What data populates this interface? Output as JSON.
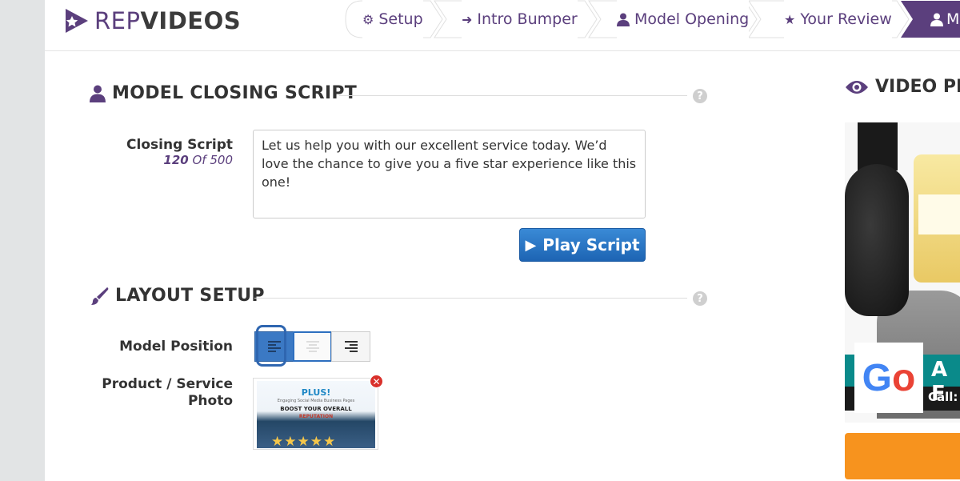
{
  "brand": {
    "rep": "REP",
    "videos": "VIDEOS",
    "accent": "#5b3f7d"
  },
  "steps": [
    {
      "label": "Setup",
      "icon": "gear-icon"
    },
    {
      "label": "Intro Bumper",
      "icon": "sign-in-icon"
    },
    {
      "label": "Model Opening",
      "icon": "user-icon"
    },
    {
      "label": "Your Review",
      "icon": "star-icon"
    },
    {
      "label": "M",
      "icon": "user-icon",
      "active": true
    }
  ],
  "closing": {
    "title": "MODEL CLOSING SCRIPT",
    "field_label": "Closing Script",
    "count": "120",
    "count_of": "Of 500",
    "script_text": "Let us help you with our excellent service today. We’d love the chance to give you a five star experience like this one!",
    "play_label": "Play Script"
  },
  "layout": {
    "title": "LAYOUT SETUP",
    "model_position_label": "Model Position",
    "position_options": [
      "left",
      "center",
      "right"
    ],
    "selected_position": "left",
    "photo_label_line1": "Product / Service",
    "photo_label_line2": "Photo",
    "photo": {
      "line1": "PLUS!",
      "line2": "Engaging Social Media Business Pages",
      "line3": "BOOST YOUR OVERALL",
      "line4": "REPUTATION",
      "stars": "★★★★★"
    }
  },
  "preview": {
    "title": "VIDEO PE",
    "bar_title": "A F",
    "bar_call": "Call:",
    "google_g": "G",
    "google_o": "o"
  },
  "help": "?",
  "remove": "✕"
}
